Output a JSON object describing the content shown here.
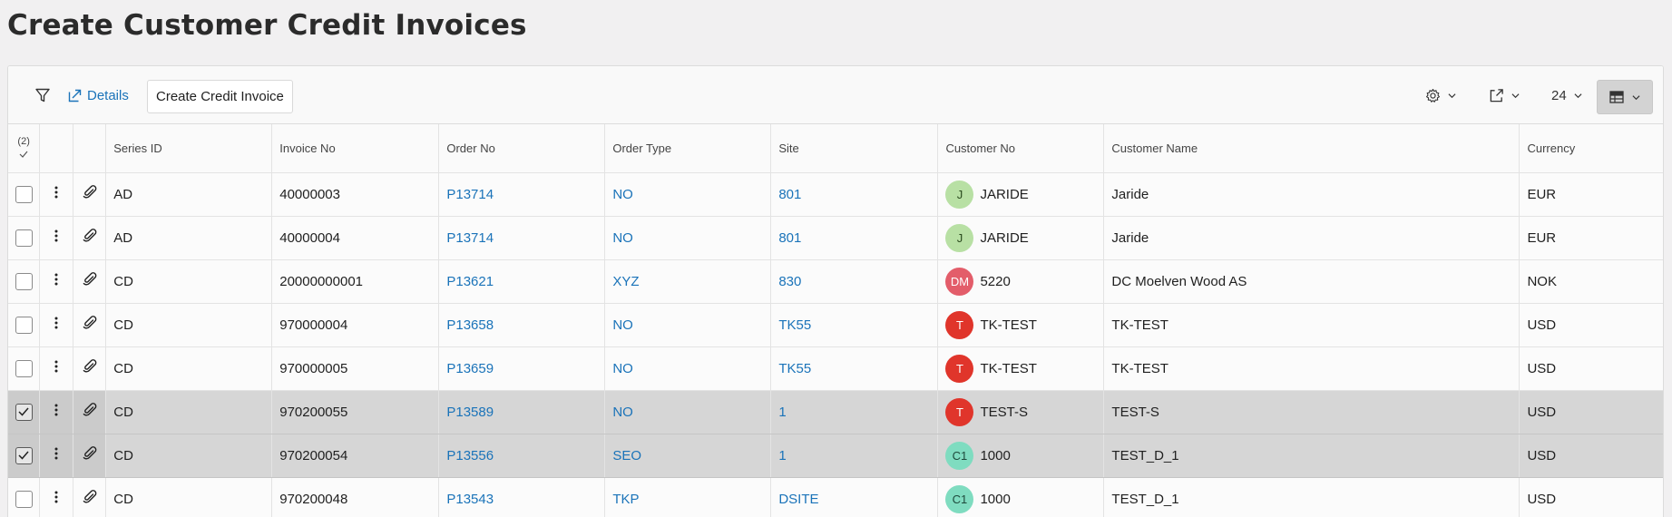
{
  "page": {
    "title": "Create Customer Credit Invoices"
  },
  "toolbar": {
    "details_label": "Details",
    "create_label": "Create Credit Invoice",
    "page_size": "24"
  },
  "table": {
    "selected_count": "(2)",
    "columns": {
      "series_id": "Series ID",
      "invoice_no": "Invoice No",
      "order_no": "Order No",
      "order_type": "Order Type",
      "site": "Site",
      "customer_no": "Customer No",
      "customer_name": "Customer Name",
      "currency": "Currency"
    },
    "rows": [
      {
        "selected": false,
        "series_id": "AD",
        "invoice_no": "40000003",
        "order_no": "P13714",
        "order_type": "NO",
        "site": "801",
        "avatar": "J",
        "avatar_color": "#b8e0a4",
        "avatar_text_color": "#2a4a1e",
        "customer_no": "JARIDE",
        "customer_name": "Jaride",
        "currency": "EUR"
      },
      {
        "selected": false,
        "series_id": "AD",
        "invoice_no": "40000004",
        "order_no": "P13714",
        "order_type": "NO",
        "site": "801",
        "avatar": "J",
        "avatar_color": "#b8e0a4",
        "avatar_text_color": "#2a4a1e",
        "customer_no": "JARIDE",
        "customer_name": "Jaride",
        "currency": "EUR"
      },
      {
        "selected": false,
        "series_id": "CD",
        "invoice_no": "20000000001",
        "order_no": "P13621",
        "order_type": "XYZ",
        "site": "830",
        "avatar": "DM",
        "avatar_color": "#e35d6a",
        "avatar_text_color": "#ffffff",
        "customer_no": "5220",
        "customer_name": "DC Moelven Wood AS",
        "currency": "NOK"
      },
      {
        "selected": false,
        "series_id": "CD",
        "invoice_no": "970000004",
        "order_no": "P13658",
        "order_type": "NO",
        "site": "TK55",
        "avatar": "T",
        "avatar_color": "#e0352b",
        "avatar_text_color": "#ffffff",
        "customer_no": "TK-TEST",
        "customer_name": "TK-TEST",
        "currency": "USD"
      },
      {
        "selected": false,
        "series_id": "CD",
        "invoice_no": "970000005",
        "order_no": "P13659",
        "order_type": "NO",
        "site": "TK55",
        "avatar": "T",
        "avatar_color": "#e0352b",
        "avatar_text_color": "#ffffff",
        "customer_no": "TK-TEST",
        "customer_name": "TK-TEST",
        "currency": "USD"
      },
      {
        "selected": true,
        "series_id": "CD",
        "invoice_no": "970200055",
        "order_no": "P13589",
        "order_type": "NO",
        "site": "1",
        "avatar": "T",
        "avatar_color": "#e0352b",
        "avatar_text_color": "#ffffff",
        "customer_no": "TEST-S",
        "customer_name": "TEST-S",
        "currency": "USD"
      },
      {
        "selected": true,
        "series_id": "CD",
        "invoice_no": "970200054",
        "order_no": "P13556",
        "order_type": "SEO",
        "site": "1",
        "avatar": "C1",
        "avatar_color": "#7fdcc0",
        "avatar_text_color": "#1e4a3c",
        "customer_no": "1000",
        "customer_name": "TEST_D_1",
        "currency": "USD"
      },
      {
        "selected": false,
        "series_id": "CD",
        "invoice_no": "970200048",
        "order_no": "P13543",
        "order_type": "TKP",
        "site": "DSITE",
        "avatar": "C1",
        "avatar_color": "#7fdcc0",
        "avatar_text_color": "#1e4a3c",
        "customer_no": "1000",
        "customer_name": "TEST_D_1",
        "currency": "USD"
      }
    ]
  }
}
